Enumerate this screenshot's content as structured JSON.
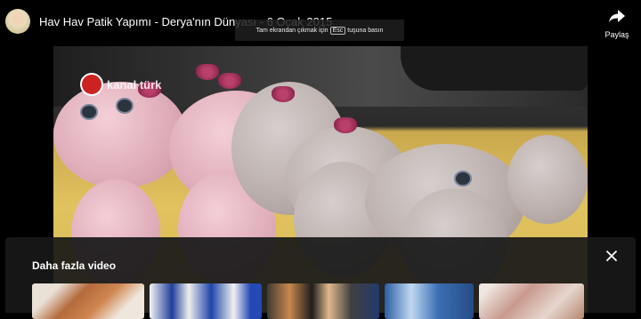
{
  "video": {
    "title": "Hav Hav Patik Yapımı - Derya'nın Dünyası - 6 Ocak 2015",
    "watermark": "kanal türk"
  },
  "share": {
    "label": "Paylaş",
    "icon": "share-arrow-icon"
  },
  "toast": {
    "prefix": "Tam ekrandan çıkmak için",
    "key": "Esc",
    "suffix": "tuşuna basın"
  },
  "more_videos": {
    "title": "Daha fazla video",
    "close_icon": "close-icon",
    "thumbnails": [
      {
        "name": "orange knitted slippers"
      },
      {
        "name": "blue white knitted booties"
      },
      {
        "name": "studio guests"
      },
      {
        "name": "street scene"
      },
      {
        "name": "pink knitting"
      }
    ]
  }
}
